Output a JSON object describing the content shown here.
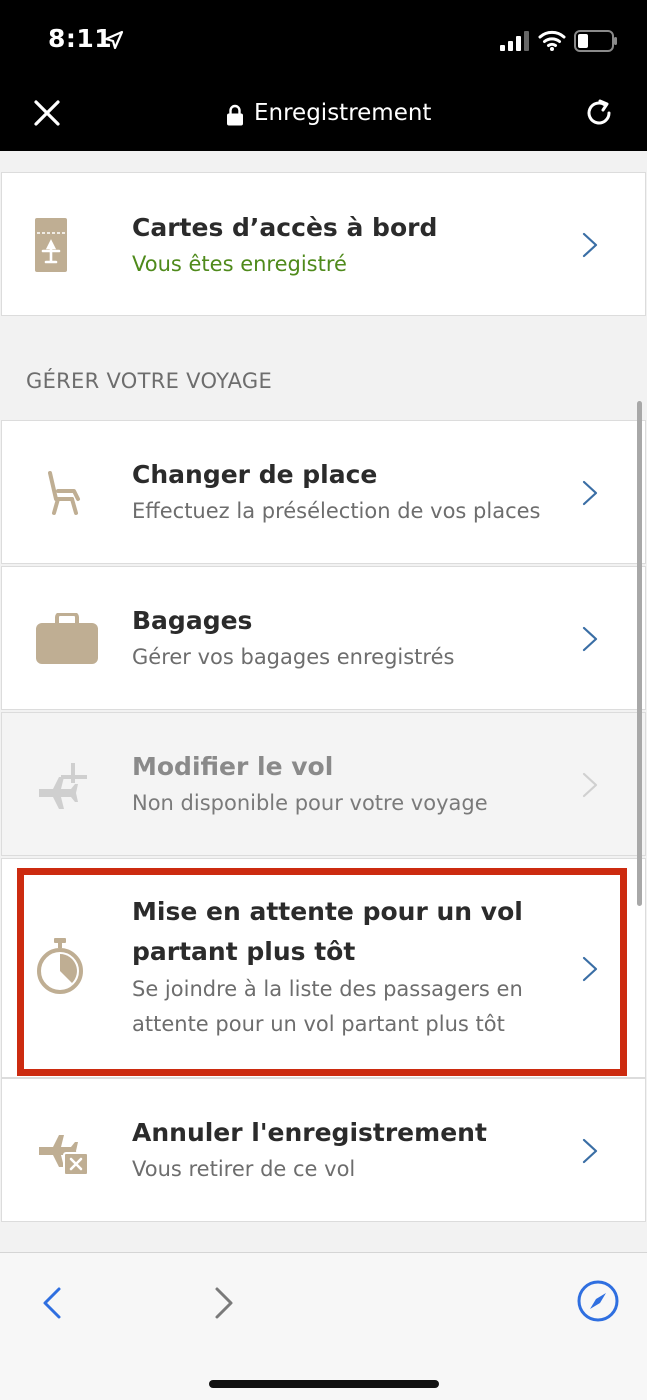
{
  "status_bar": {
    "time": "8:11",
    "location_icon": "location-arrow-icon",
    "signal_icon": "cellular-signal-icon",
    "wifi_icon": "wifi-icon",
    "battery_icon": "battery-icon"
  },
  "nav": {
    "close_icon": "close-icon",
    "lock_icon": "lock-icon",
    "title": "Enregistrement",
    "reload_icon": "reload-icon"
  },
  "boarding": {
    "title": "Cartes d’accès à bord",
    "subtitle": "Vous êtes enregistré",
    "icon": "boarding-pass-icon"
  },
  "section_label": "GÉRER VOTRE VOYAGE",
  "items": [
    {
      "title": "Changer de place",
      "subtitle": "Effectuez la présélection de vos places",
      "icon": "seat-icon",
      "disabled": false
    },
    {
      "title": "Bagages",
      "subtitle": "Gérer vos bagages enregistrés",
      "icon": "suitcase-icon",
      "disabled": false
    },
    {
      "title": "Modifier le vol",
      "subtitle": "Non disponible pour votre voyage",
      "icon": "change-flight-icon",
      "disabled": true
    },
    {
      "title_line1": "Mise en attente pour un vol",
      "title_line2": "partant plus tôt",
      "subtitle_line1": "Se joindre à la liste des passagers en",
      "subtitle_line2": "attente pour un vol partant plus tôt",
      "icon": "stopwatch-icon",
      "disabled": false,
      "highlighted": true
    },
    {
      "title": "Annuler l'enregistrement",
      "subtitle": "Vous retirer de ce vol",
      "icon": "cancel-flight-icon",
      "disabled": false
    }
  ],
  "bottom_bar": {
    "back_icon": "back-arrow-icon",
    "forward_icon": "forward-arrow-icon",
    "compass_icon": "compass-icon"
  },
  "colors": {
    "accent_brown": "#bfae93",
    "checked_in_green": "#4f8a1b",
    "chevron_blue": "#3a6ea5",
    "highlight_red": "#cc2b10",
    "link_blue": "#2f6fe0"
  }
}
